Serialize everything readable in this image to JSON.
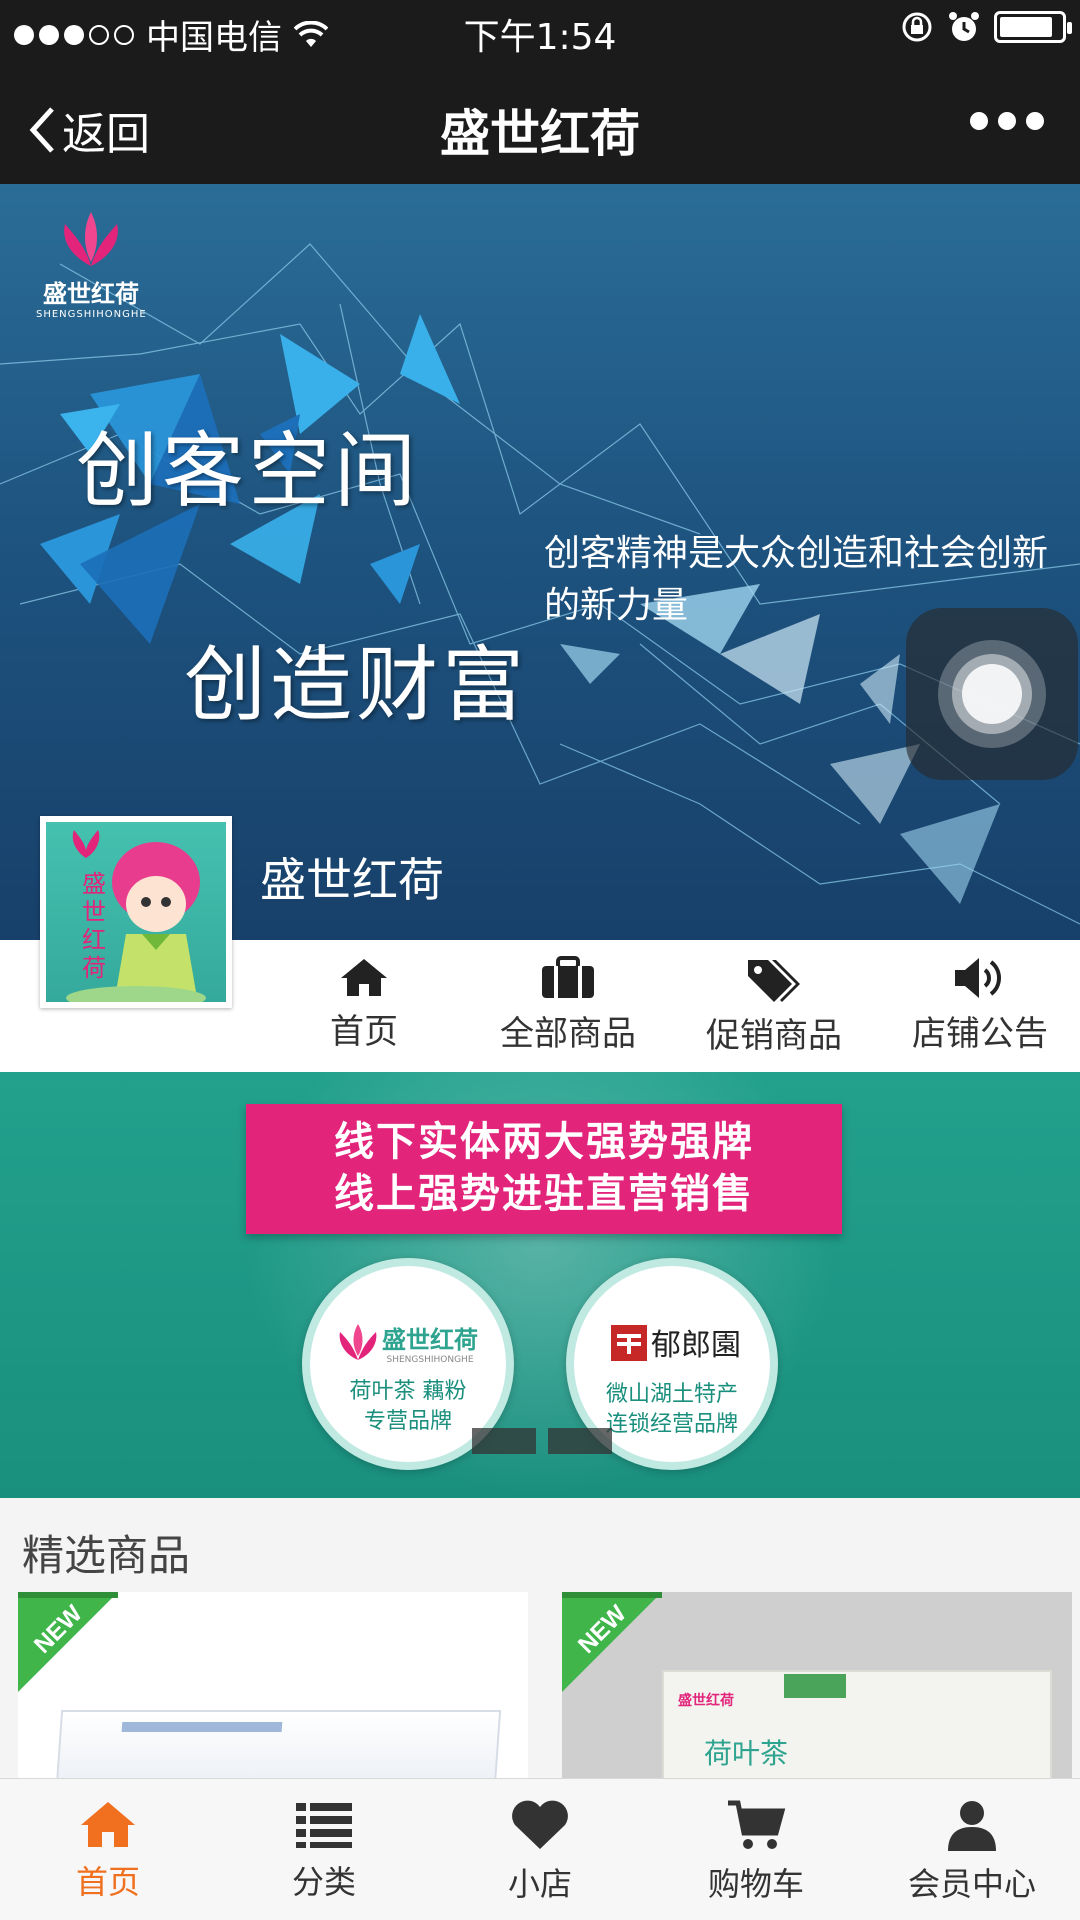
{
  "status_bar": {
    "carrier": "中国电信",
    "time": "下午1:54"
  },
  "navbar": {
    "back_label": "返回",
    "title": "盛世红荷"
  },
  "hero": {
    "logo_brand": "盛世红荷",
    "logo_pinyin": "SHENGSHIHONGHE",
    "headline_1": "创客空间",
    "headline_2": "创造财富",
    "slogan": "创客精神是大众创造和社会创新的新力量",
    "shop_name": "盛世红荷"
  },
  "shop_nav": [
    {
      "label": "首页",
      "icon": "home-icon"
    },
    {
      "label": "全部商品",
      "icon": "briefcase-icon"
    },
    {
      "label": "促销商品",
      "icon": "tags-icon"
    },
    {
      "label": "店铺公告",
      "icon": "speaker-icon"
    }
  ],
  "promo": {
    "ribbon_line_1": "线下实体两大强势强牌",
    "ribbon_line_2": "线上强势进驻直营销售",
    "brand_1_name": "盛世红荷",
    "brand_1_pinyin": "SHENGSHIHONGHE",
    "brand_1_desc_1": "荷叶茶 藕粉",
    "brand_1_desc_2": "专营品牌",
    "brand_2_name": "郁郎園",
    "brand_2_desc_1": "微山湖土特产",
    "brand_2_desc_2": "连锁经营品牌"
  },
  "featured": {
    "title": "精选商品",
    "badge": "NEW",
    "product_2_brand": "盛世红荷",
    "product_2_name": "荷叶茶"
  },
  "tab_bar": [
    {
      "label": "首页",
      "icon": "home-icon",
      "active": true
    },
    {
      "label": "分类",
      "icon": "list-icon",
      "active": false
    },
    {
      "label": "小店",
      "icon": "heart-icon",
      "active": false
    },
    {
      "label": "购物车",
      "icon": "cart-icon",
      "active": false
    },
    {
      "label": "会员中心",
      "icon": "user-icon",
      "active": false
    }
  ],
  "colors": {
    "accent": "#f07020",
    "promo_pink": "#e2247b",
    "promo_teal": "#22a18d",
    "bar_dark": "#1b1b1b"
  }
}
